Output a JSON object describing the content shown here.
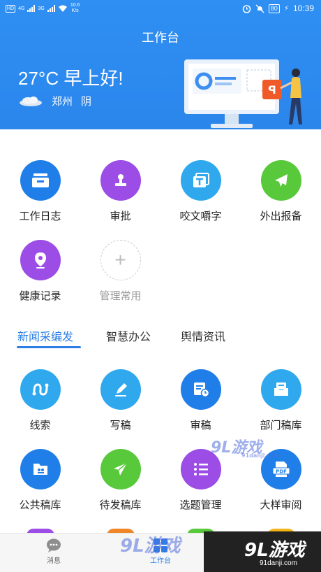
{
  "status_bar": {
    "hd_label": "HD",
    "network_label": "4G",
    "network_label2": "3G",
    "speed_value": "10.6",
    "speed_unit": "K/s",
    "battery": "80",
    "time": "10:39"
  },
  "header": {
    "title": "工作台",
    "greeting": "27°C 早上好!",
    "city": "郑州",
    "weather": "阴"
  },
  "shortcuts": [
    {
      "label": "工作日志",
      "icon": "work-log-icon",
      "color": "#1f7ee8"
    },
    {
      "label": "审批",
      "icon": "approval-stamp-icon",
      "color": "#9b4de6"
    },
    {
      "label": "咬文嚼字",
      "icon": "text-icon",
      "color": "#2fa8ee"
    },
    {
      "label": "外出报备",
      "icon": "airplane-icon",
      "color": "#58c93a"
    },
    {
      "label": "健康记录",
      "icon": "location-pin-icon",
      "color": "#9b4de6"
    },
    {
      "label": "管理常用",
      "icon": "plus-icon",
      "color": "#cccccc"
    }
  ],
  "tabs": [
    "新闻采编发",
    "智慧办公",
    "舆情资讯"
  ],
  "functions": [
    {
      "label": "线索",
      "icon": "clue-icon",
      "color": "#2fa8ee"
    },
    {
      "label": "写稿",
      "icon": "pen-icon",
      "color": "#2fa8ee"
    },
    {
      "label": "审稿",
      "icon": "review-icon",
      "color": "#1f7ee8"
    },
    {
      "label": "部门稿库",
      "icon": "department-library-icon",
      "color": "#2fa8ee"
    },
    {
      "label": "公共稿库",
      "icon": "public-library-icon",
      "color": "#1f7ee8"
    },
    {
      "label": "待发稿库",
      "icon": "send-icon",
      "color": "#58c93a"
    },
    {
      "label": "选题管理",
      "icon": "list-icon",
      "color": "#9b4de6"
    },
    {
      "label": "大样审阅",
      "icon": "pdf-icon",
      "color": "#1f7ee8"
    }
  ],
  "bottom_nav": {
    "messages": "消息",
    "workbench": "工作台"
  },
  "watermark": {
    "brand": "9L游戏",
    "domain": "91danji.com"
  },
  "colors": {
    "header_blue": "#2d8cf0",
    "accent": "#2d7fe6"
  }
}
